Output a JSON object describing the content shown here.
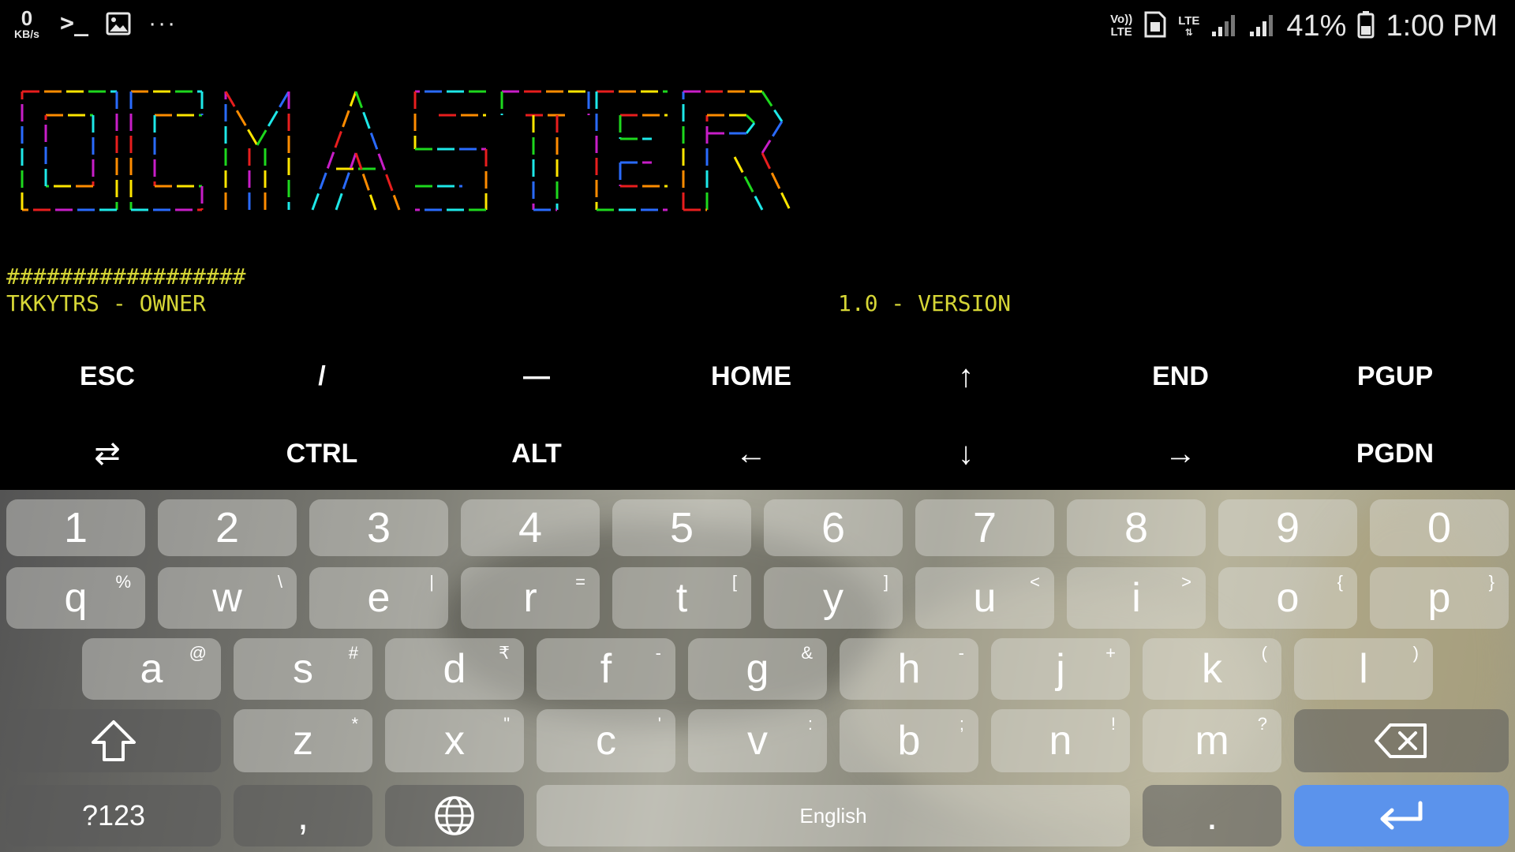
{
  "status_bar": {
    "data_rate_value": "0",
    "data_rate_unit": "KB/s",
    "terminal_icon": ">_",
    "more_icon": "···",
    "volte_top": "Vo))",
    "volte_bottom": "LTE",
    "lte_label": "LTE",
    "battery_percent": "41%",
    "time": "1:00 PM"
  },
  "terminal": {
    "banner_colors": [
      "#e81e1e",
      "#ff8c00",
      "#ffe600",
      "#1ed81e",
      "#1ee8e8",
      "#2a6bff",
      "#c81ec8"
    ],
    "hash_line": "##################",
    "owner": "TKKYTRS - OWNER",
    "version": "1.0 - VERSION"
  },
  "extra_keys": {
    "row1": [
      "ESC",
      "/",
      "—",
      "HOME",
      "↑",
      "END",
      "PGUP"
    ],
    "row2": [
      "⇄",
      "CTRL",
      "ALT",
      "←",
      "↓",
      "→",
      "PGDN"
    ]
  },
  "keyboard": {
    "numbers": [
      "1",
      "2",
      "3",
      "4",
      "5",
      "6",
      "7",
      "8",
      "9",
      "0"
    ],
    "row_q": [
      {
        "k": "q",
        "h": "%"
      },
      {
        "k": "w",
        "h": "\\"
      },
      {
        "k": "e",
        "h": "|"
      },
      {
        "k": "r",
        "h": "="
      },
      {
        "k": "t",
        "h": "["
      },
      {
        "k": "y",
        "h": "]"
      },
      {
        "k": "u",
        "h": "<"
      },
      {
        "k": "i",
        "h": ">"
      },
      {
        "k": "o",
        "h": "{"
      },
      {
        "k": "p",
        "h": "}"
      }
    ],
    "row_a": [
      {
        "k": "a",
        "h": "@"
      },
      {
        "k": "s",
        "h": "#"
      },
      {
        "k": "d",
        "h": "₹"
      },
      {
        "k": "f",
        "h": "-"
      },
      {
        "k": "g",
        "h": "&"
      },
      {
        "k": "h",
        "h": "-"
      },
      {
        "k": "j",
        "h": "+"
      },
      {
        "k": "k",
        "h": "("
      },
      {
        "k": "l",
        "h": ")"
      }
    ],
    "row_z": [
      {
        "k": "z",
        "h": "*"
      },
      {
        "k": "x",
        "h": "\""
      },
      {
        "k": "c",
        "h": "'"
      },
      {
        "k": "v",
        "h": ":"
      },
      {
        "k": "b",
        "h": ";"
      },
      {
        "k": "n",
        "h": "!"
      },
      {
        "k": "m",
        "h": "?"
      }
    ],
    "symbols_label": "?123",
    "comma_label": ",",
    "space_label": "English",
    "period_label": "."
  }
}
